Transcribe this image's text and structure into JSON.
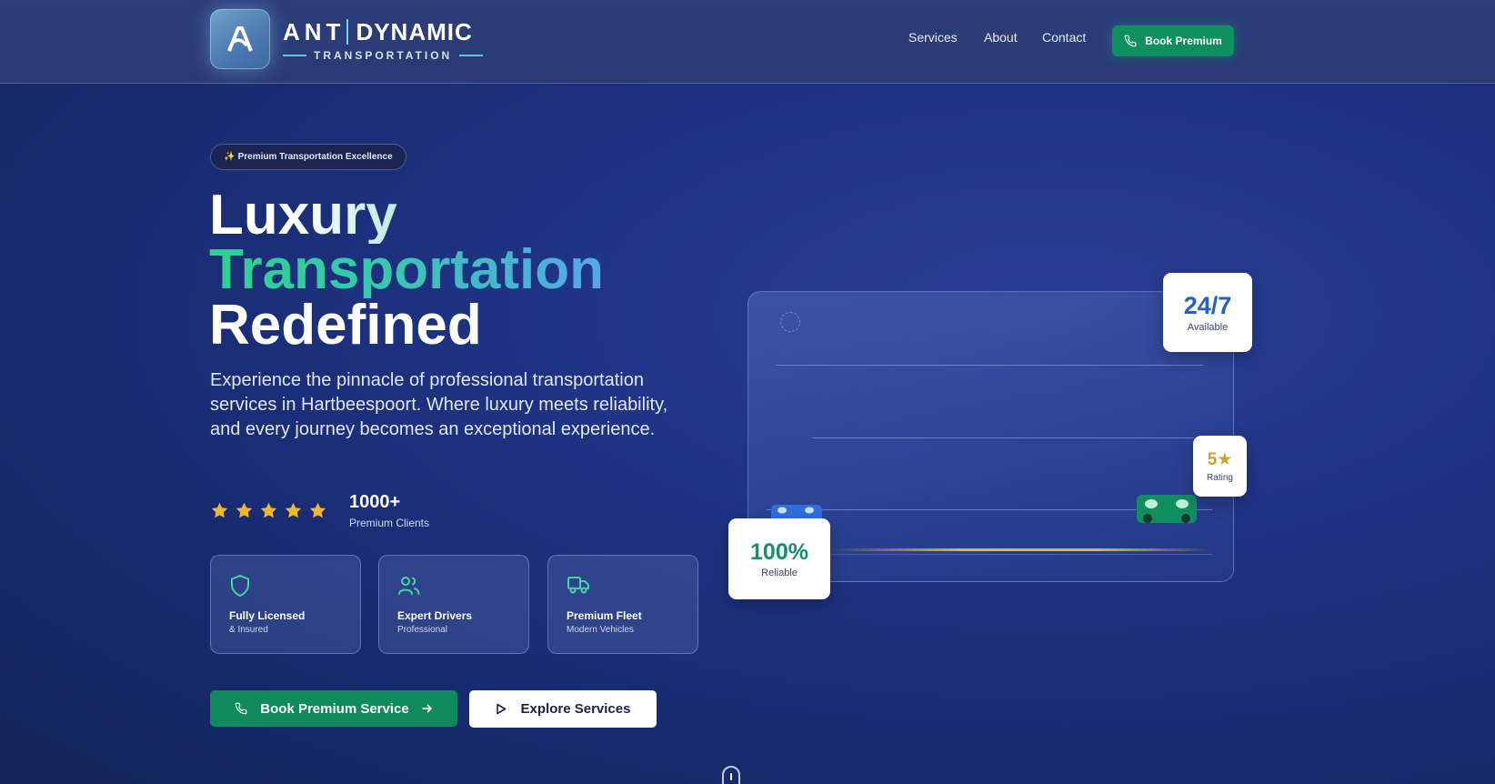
{
  "header": {
    "brand_primary": "ANT",
    "brand_secondary": "DYNAMIC",
    "brand_tagline": "TRANSPORTATION",
    "nav": [
      "Services",
      "About",
      "Contact"
    ],
    "cta_label": "Book Premium"
  },
  "hero": {
    "badge": "✨ Premium Transportation Excellence",
    "headline": [
      "Luxury",
      "Transportation",
      "Redefined"
    ],
    "description": "Experience the pinnacle of professional transportation services in Hartbeespoort. Where luxury meets reliability, and every journey becomes an exceptional experience.",
    "rating_stars": 5,
    "clients_count": "1000+",
    "clients_label": "Premium Clients",
    "features": [
      {
        "icon": "shield-icon",
        "title": "Fully Licensed",
        "subtitle": "& Insured"
      },
      {
        "icon": "users-icon",
        "title": "Expert Drivers",
        "subtitle": "Professional"
      },
      {
        "icon": "truck-icon",
        "title": "Premium Fleet",
        "subtitle": "Modern Vehicles"
      }
    ],
    "primary_cta": "Book Premium Service",
    "secondary_cta": "Explore Services"
  },
  "illustration": {
    "availability": {
      "value": "24/7",
      "label": "Available"
    },
    "rating": {
      "value": "5★",
      "label": "Rating"
    },
    "reliability": {
      "value": "100%",
      "label": "Reliable"
    }
  },
  "colors": {
    "background": "#1e3384",
    "accent_green": "#0f8f5e",
    "gradient_teal": "#2fd08e",
    "gradient_blue": "#58a6e8",
    "star": "#f5b62a",
    "gold_stat": "#c9a232"
  }
}
